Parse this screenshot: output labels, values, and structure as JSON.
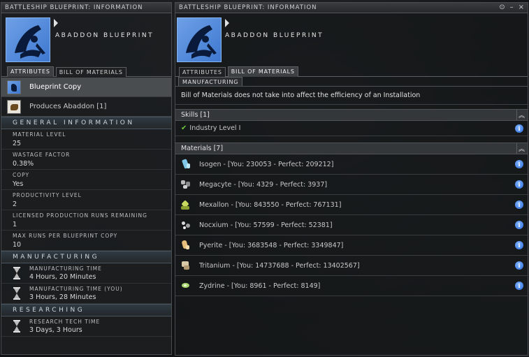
{
  "left_window": {
    "title": "BATTLESHIP BLUEPRINT: INFORMATION",
    "item_name": "ABADDON BLUEPRINT",
    "tabs": [
      {
        "label": "ATTRIBUTES",
        "active": true
      },
      {
        "label": "BILL OF MATERIALS",
        "active": false
      }
    ],
    "items": [
      {
        "label": "Blueprint Copy",
        "icon": "blueprint-icon"
      },
      {
        "label": "Produces Abaddon [1]",
        "icon": "ship-icon"
      }
    ],
    "sections": {
      "general": "GENERAL INFORMATION",
      "manufacturing": "MANUFACTURING",
      "researching": "RESEARCHING"
    },
    "attributes": [
      {
        "label": "MATERIAL LEVEL",
        "value": "25"
      },
      {
        "label": "WASTAGE FACTOR",
        "value": "0.38%"
      },
      {
        "label": "COPY",
        "value": "Yes"
      },
      {
        "label": "PRODUCTIVITY LEVEL",
        "value": "2"
      },
      {
        "label": "LICENSED PRODUCTION RUNS REMAINING",
        "value": "1"
      },
      {
        "label": "MAX RUNS PER BLUEPRINT COPY",
        "value": "10"
      }
    ],
    "manufacturing_times": [
      {
        "label": "MANUFACTURING TIME",
        "value": "4 Hours, 20 Minutes"
      },
      {
        "label": "MANUFACTURING TIME (YOU)",
        "value": "3 Hours, 28 Minutes"
      }
    ],
    "research_times": [
      {
        "label": "RESEARCH TECH TIME",
        "value": "3 Days, 3 Hours"
      }
    ]
  },
  "right_window": {
    "title": "BATTLESHIP BLUEPRINT: INFORMATION",
    "controls": {
      "pin": "⊙",
      "minimize": "–",
      "close": "×"
    },
    "item_name": "ABADDON BLUEPRINT",
    "tabs": [
      {
        "label": "ATTRIBUTES",
        "active": false
      },
      {
        "label": "BILL OF MATERIALS",
        "active": true
      }
    ],
    "subtab": "MANUFACTURING",
    "note": "Bill of Materials does not take into affect the efficiency of an Installation",
    "skills_header": "Skills [1]",
    "skills": [
      {
        "label": "Industry Level I"
      }
    ],
    "materials_header": "Materials [7]",
    "materials": [
      {
        "label": "Isogen - [You: 230053 - Perfect: 209212]",
        "icon": "isogen-icon",
        "color": "#7fc6e8"
      },
      {
        "label": "Megacyte - [You: 4329 - Perfect: 3937]",
        "icon": "megacyte-icon",
        "color": "#b8b8b8"
      },
      {
        "label": "Mexallon - [You: 843550 - Perfect: 767131]",
        "icon": "mexallon-icon",
        "color": "#c8d860"
      },
      {
        "label": "Nocxium - [You: 57599 - Perfect: 52381]",
        "icon": "nocxium-icon",
        "color": "#d8d8d8"
      },
      {
        "label": "Pyerite - [You: 3683548 - Perfect: 3349847]",
        "icon": "pyerite-icon",
        "color": "#e6c07a"
      },
      {
        "label": "Tritanium - [You: 14737688 - Perfect: 13402567]",
        "icon": "tritanium-icon",
        "color": "#d8c8a8"
      },
      {
        "label": "Zydrine - [You: 8961 - Perfect: 8149]",
        "icon": "zydrine-icon",
        "color": "#a8d870"
      }
    ]
  }
}
